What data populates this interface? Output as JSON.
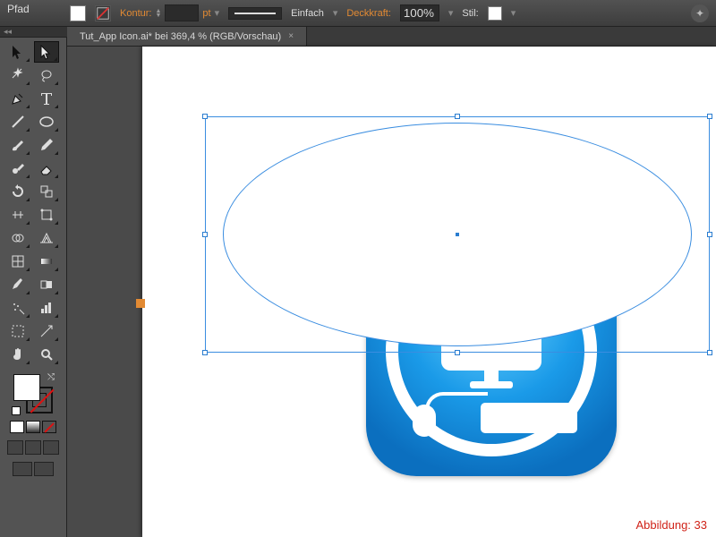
{
  "ctrl": {
    "object_label": "Pfad",
    "kontur_label": "Kontur:",
    "pt_value": "",
    "pt_unit": "pt",
    "profile_label": "Einfach",
    "opacity_label": "Deckkraft:",
    "opacity_value": "100%",
    "style_label": "Stil:"
  },
  "doc": {
    "tab_title": "Tut_App Icon.ai* bei 369,4 % (RGB/Vorschau)",
    "close": "×"
  },
  "toolbar_handle": "◂◂",
  "tools": [
    {
      "name": "selection-tool",
      "selected": false
    },
    {
      "name": "direct-selection-tool",
      "selected": true
    },
    {
      "name": "magic-wand-tool"
    },
    {
      "name": "lasso-tool"
    },
    {
      "name": "pen-tool"
    },
    {
      "name": "type-tool"
    },
    {
      "name": "line-tool"
    },
    {
      "name": "ellipse-tool"
    },
    {
      "name": "paintbrush-tool"
    },
    {
      "name": "pencil-tool"
    },
    {
      "name": "blob-brush-tool"
    },
    {
      "name": "eraser-tool"
    },
    {
      "name": "rotate-tool"
    },
    {
      "name": "scale-tool"
    },
    {
      "name": "width-tool"
    },
    {
      "name": "free-transform-tool"
    },
    {
      "name": "shape-builder-tool"
    },
    {
      "name": "perspective-grid-tool"
    },
    {
      "name": "mesh-tool"
    },
    {
      "name": "gradient-tool"
    },
    {
      "name": "eyedropper-tool"
    },
    {
      "name": "blend-tool"
    },
    {
      "name": "symbol-sprayer-tool"
    },
    {
      "name": "column-graph-tool"
    },
    {
      "name": "artboard-tool"
    },
    {
      "name": "slice-tool"
    },
    {
      "name": "hand-tool"
    },
    {
      "name": "zoom-tool"
    }
  ],
  "caption": "Abbildung: 33"
}
